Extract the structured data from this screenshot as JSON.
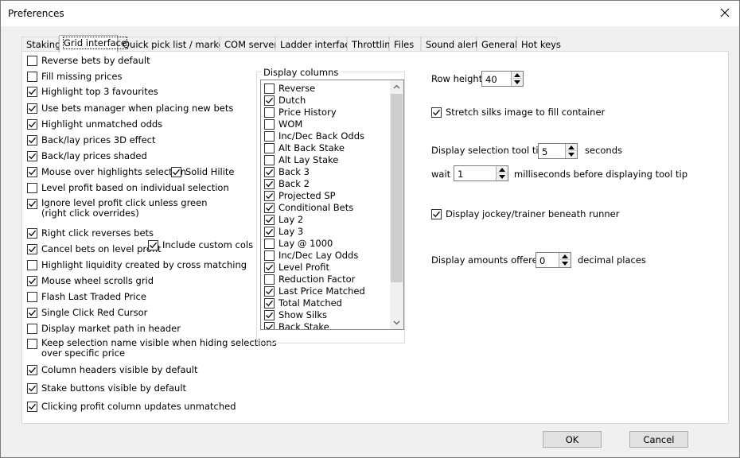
{
  "window": {
    "title": "Preferences"
  },
  "tabs": [
    "Staking",
    "Grid interface",
    "Quick pick list / markets",
    "COM server",
    "Ladder interface",
    "Throttling",
    "Files",
    "Sound alerts",
    "General",
    "Hot keys"
  ],
  "active_tab": "Grid interface",
  "options": {
    "reverse_bets": {
      "label": "Reverse bets by default",
      "checked": false
    },
    "fill_missing": {
      "label": "Fill missing prices",
      "checked": false
    },
    "highlight_top3": {
      "label": "Highlight top 3 favourites",
      "checked": true
    },
    "bets_manager": {
      "label": "Use bets manager when placing new bets",
      "checked": true
    },
    "highlight_unmatched": {
      "label": "Highlight unmatched odds",
      "checked": true
    },
    "prices_3d": {
      "label": "Back/lay prices 3D effect",
      "checked": true
    },
    "prices_shaded": {
      "label": "Back/lay prices shaded",
      "checked": true
    },
    "mouse_over": {
      "label": "Mouse over highlights selection",
      "checked": true
    },
    "solid_hilite": {
      "label": "Solid Hilite",
      "checked": true
    },
    "level_profit": {
      "label": "Level profit based on individual selection",
      "checked": false
    },
    "ignore_level": {
      "label": "Ignore level profit click unless green\n(right click overrides)",
      "checked": true
    },
    "right_click_reverses": {
      "label": "Right click reverses bets",
      "checked": true
    },
    "cancel_on_level": {
      "label": "Cancel bets on level profit",
      "checked": true
    },
    "include_custom": {
      "label": "Include custom cols",
      "checked": true
    },
    "highlight_liquidity": {
      "label": "Highlight liquidity created by cross matching",
      "checked": false
    },
    "mouse_wheel": {
      "label": "Mouse wheel scrolls grid",
      "checked": true
    },
    "flash_last": {
      "label": "Flash Last Traded Price",
      "checked": false
    },
    "single_click": {
      "label": "Single Click Red Cursor",
      "checked": true
    },
    "market_path": {
      "label": "Display market path in header",
      "checked": false
    },
    "keep_name": {
      "label": "Keep selection name visible when hiding selections\nover specific price",
      "checked": false
    },
    "column_headers": {
      "label": "Column headers visible by default",
      "checked": true
    },
    "stake_buttons": {
      "label": "Stake buttons visible by default",
      "checked": true
    },
    "profit_column": {
      "label": "Clicking profit column updates unmatched",
      "checked": true
    }
  },
  "display_columns": {
    "title": "Display columns",
    "items": [
      {
        "label": "Reverse",
        "checked": false
      },
      {
        "label": "Dutch",
        "checked": true
      },
      {
        "label": "Price History",
        "checked": false
      },
      {
        "label": "WOM",
        "checked": false
      },
      {
        "label": "Inc/Dec Back Odds",
        "checked": false
      },
      {
        "label": "Alt Back Stake",
        "checked": false
      },
      {
        "label": "Alt Lay Stake",
        "checked": false
      },
      {
        "label": "Back 3",
        "checked": true
      },
      {
        "label": "Back 2",
        "checked": true
      },
      {
        "label": "Projected SP",
        "checked": true
      },
      {
        "label": "Conditional Bets",
        "checked": true
      },
      {
        "label": "Lay 2",
        "checked": true
      },
      {
        "label": "Lay 3",
        "checked": true
      },
      {
        "label": "Lay @ 1000",
        "checked": false
      },
      {
        "label": "Inc/Dec Lay Odds",
        "checked": false
      },
      {
        "label": "Level Profit",
        "checked": true
      },
      {
        "label": "Reduction Factor",
        "checked": false
      },
      {
        "label": "Last Price Matched",
        "checked": true
      },
      {
        "label": "Total Matched",
        "checked": true
      },
      {
        "label": "Show Silks",
        "checked": true
      },
      {
        "label": "Back Stake",
        "checked": true
      }
    ]
  },
  "right": {
    "row_height_label": "Row height",
    "row_height_value": "40",
    "stretch_silks": {
      "label": "Stretch silks image to fill container",
      "checked": true
    },
    "tooltip_label": "Display selection tool tip for",
    "tooltip_value": "5",
    "tooltip_unit": "seconds",
    "wait_label": "wait",
    "wait_value": "1",
    "wait_unit": "milliseconds before displaying tool tip",
    "jockey": {
      "label": "Display jockey/trainer beneath runner",
      "checked": true
    },
    "amounts_label": "Display amounts offered to",
    "amounts_value": "0",
    "amounts_unit": "decimal places"
  },
  "buttons": {
    "ok": "OK",
    "cancel": "Cancel"
  }
}
